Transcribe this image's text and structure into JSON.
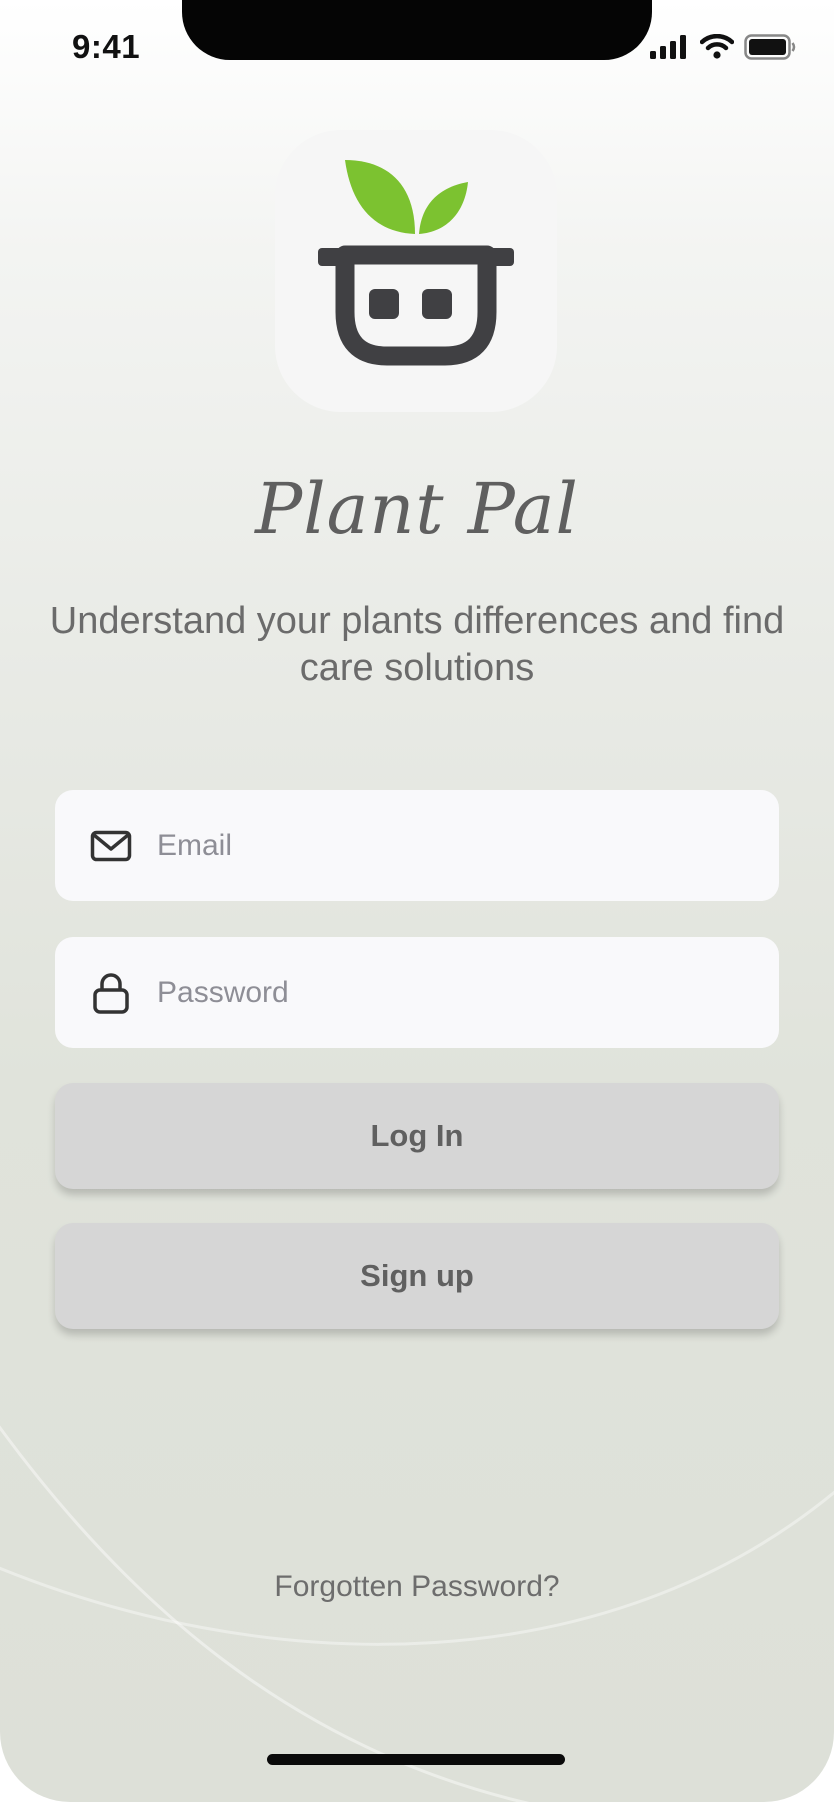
{
  "status_bar": {
    "time": "9:41",
    "icons": [
      "cellular-signal-icon",
      "wifi-icon",
      "battery-icon"
    ]
  },
  "logo": {
    "icon": "plant-pot-robot-icon",
    "colors": {
      "leaf": "#7cc230",
      "pot": "#404043",
      "tile": "#f6f6f6"
    }
  },
  "app_name": "Plant Pal",
  "tagline": "Understand your plants differences and find care solutions",
  "form": {
    "email": {
      "icon": "mail-icon",
      "placeholder": "Email",
      "value": ""
    },
    "password": {
      "icon": "lock-icon",
      "placeholder": "Password",
      "value": ""
    }
  },
  "buttons": {
    "login_label": "Log In",
    "signup_label": "Sign up"
  },
  "forgot_password_label": "Forgotten Password?",
  "theme": {
    "background": "#e3e6df",
    "button_bg": "#d6d6d6",
    "text": "#6b6b6b"
  }
}
